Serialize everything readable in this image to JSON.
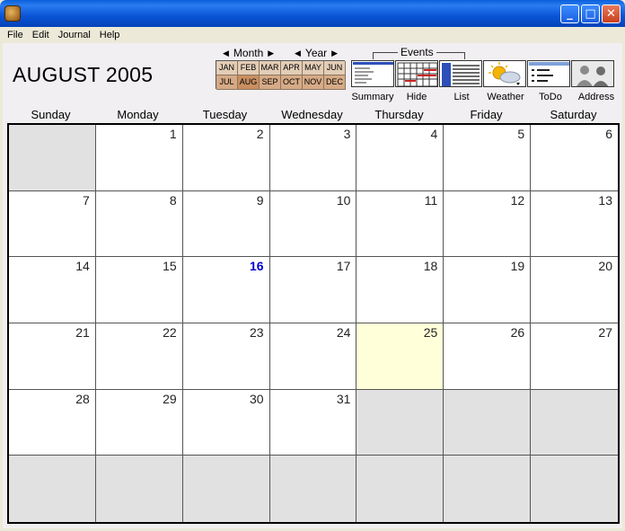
{
  "menu": [
    "File",
    "Edit",
    "Journal",
    "Help"
  ],
  "header": {
    "title": "AUGUST 2005"
  },
  "nav": {
    "month_label": "Month",
    "year_label": "Year",
    "left_arrow": "◀",
    "right_arrow": "▶"
  },
  "months": [
    "JAN",
    "FEB",
    "MAR",
    "APR",
    "MAY",
    "JUN",
    "JUL",
    "AUG",
    "SEP",
    "OCT",
    "NOV",
    "DEC"
  ],
  "selected_month": "AUG",
  "events_label": "Events",
  "toolbar": [
    {
      "label": "Summary",
      "icon": "summary-icon"
    },
    {
      "label": "Hide",
      "icon": "hide-icon"
    },
    {
      "label": "List",
      "icon": "list-icon"
    },
    {
      "label": "Weather",
      "icon": "weather-icon"
    },
    {
      "label": "ToDo",
      "icon": "todo-icon"
    },
    {
      "label": "Address",
      "icon": "address-icon"
    }
  ],
  "weekdays": [
    "Sunday",
    "Monday",
    "Tuesday",
    "Wednesday",
    "Thursday",
    "Friday",
    "Saturday"
  ],
  "calendar": {
    "first_weekday_index": 1,
    "days_in_month": 31,
    "today": 16,
    "selected": 25
  },
  "colors": {
    "today": "#0000CC",
    "selected_bg": "#FFFFD9",
    "empty_bg": "#E1E1E1"
  }
}
